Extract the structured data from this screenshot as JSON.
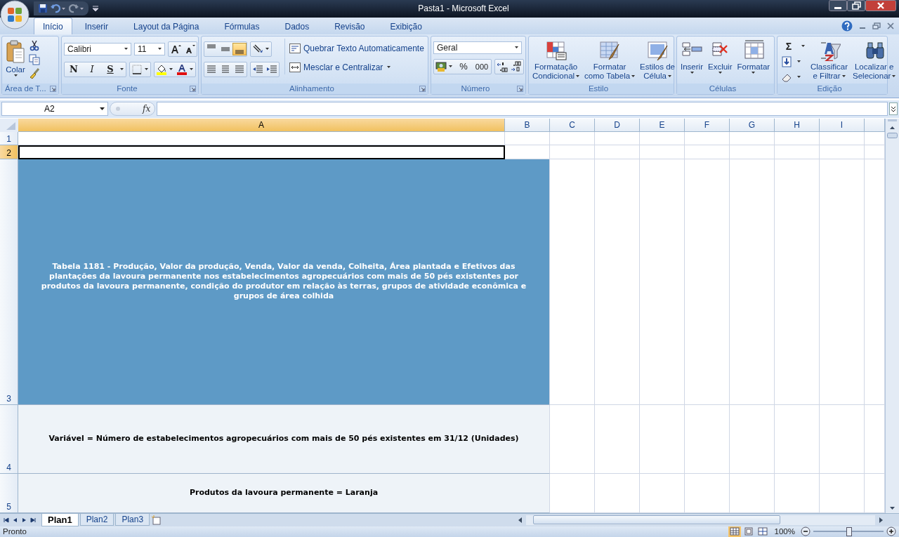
{
  "window": {
    "title": "Pasta1 - Microsoft Excel"
  },
  "tabs": [
    {
      "label": "Início",
      "selected": true
    },
    {
      "label": "Inserir",
      "selected": false
    },
    {
      "label": "Layout da Página",
      "selected": false
    },
    {
      "label": "Fórmulas",
      "selected": false
    },
    {
      "label": "Dados",
      "selected": false
    },
    {
      "label": "Revisão",
      "selected": false
    },
    {
      "label": "Exibição",
      "selected": false
    }
  ],
  "ribbon": {
    "groups": [
      {
        "kind": "clipboard",
        "name": "Área de T...",
        "launcher": true,
        "paste": "Colar"
      },
      {
        "kind": "font",
        "name": "Fonte",
        "launcher": true,
        "font": "Calibri",
        "size": "11",
        "bold": "N",
        "italic": "I",
        "underline": "S"
      },
      {
        "kind": "alignment",
        "name": "Alinhamento",
        "launcher": true,
        "vertical_align": [
          {
            "selected": false
          },
          {
            "selected": false
          },
          {
            "selected": true
          }
        ],
        "wrap": "Quebrar Texto Automaticamente",
        "merge": "Mesclar e Centralizar"
      },
      {
        "kind": "number",
        "name": "Número",
        "launcher": true,
        "format": "Geral",
        "percent": "%",
        "thousands": "000"
      },
      {
        "kind": "large",
        "name": "Estilo",
        "launcher": false,
        "buttons": [
          {
            "lines": [
              "Formatação",
              "Condicional"
            ]
          },
          {
            "lines": [
              "Formatar",
              "como Tabela"
            ]
          },
          {
            "lines": [
              "Estilos de",
              "Célula"
            ]
          }
        ]
      },
      {
        "kind": "cells",
        "name": "Células",
        "launcher": false,
        "buttons": [
          {
            "lines": [
              "Inserir"
            ]
          },
          {
            "lines": [
              "Excluir"
            ]
          },
          {
            "lines": [
              "Formatar"
            ]
          }
        ]
      },
      {
        "kind": "editing",
        "name": "Edição",
        "launcher": false,
        "sum": "Σ",
        "buttons": [
          {
            "lines": [
              "Classificar",
              "e Filtrar"
            ]
          },
          {
            "lines": [
              "Localizar e",
              "Selecionar"
            ]
          }
        ]
      }
    ]
  },
  "formula_bar": {
    "name_box": "A2",
    "function_label": "fx"
  },
  "columns": [
    {
      "label": "A",
      "selected": true
    },
    {
      "label": "B",
      "selected": false
    },
    {
      "label": "C",
      "selected": false
    },
    {
      "label": "D",
      "selected": false
    },
    {
      "label": "E",
      "selected": false
    },
    {
      "label": "F",
      "selected": false
    },
    {
      "label": "G",
      "selected": false
    },
    {
      "label": "H",
      "selected": false
    },
    {
      "label": "I",
      "selected": false
    }
  ],
  "rows": [
    {
      "header": "1",
      "selected": false,
      "active_cell": false
    },
    {
      "header": "2",
      "selected": true,
      "active_cell": true
    },
    {
      "header": "3",
      "selected": false,
      "active_cell": false,
      "merged_cell": {
        "kind": "title",
        "text": "Tabela 1181 - Produção, Valor da produção, Venda, Valor da venda, Colheita, Área plantada e Efetivos das plantações da lavoura permanente nos estabelecimentos agropecuários com mais de 50 pés existentes por produtos da lavoura permanente, condição do produtor em relação às terras, grupos de atividade econômica e grupos de área colhida"
      }
    },
    {
      "header": "4",
      "selected": false,
      "active_cell": false,
      "merged_cell": {
        "kind": "label",
        "text": "Variável = Número de estabelecimentos agropecuários com mais de 50 pés existentes em 31/12 (Unidades)"
      }
    },
    {
      "header": "5",
      "selected": false,
      "active_cell": false,
      "merged_cell": {
        "kind": "label",
        "text": "Produtos da lavoura permanente = Laranja"
      }
    }
  ],
  "sheets": [
    {
      "label": "Plan1",
      "selected": true
    },
    {
      "label": "Plan2",
      "selected": false
    },
    {
      "label": "Plan3",
      "selected": false
    }
  ],
  "status_bar": {
    "text": "Pronto",
    "views": [
      {
        "selected": true
      },
      {
        "selected": false
      },
      {
        "selected": false
      }
    ],
    "zoom": "100%",
    "zoom_slider": {
      "level": 0.5
    }
  }
}
